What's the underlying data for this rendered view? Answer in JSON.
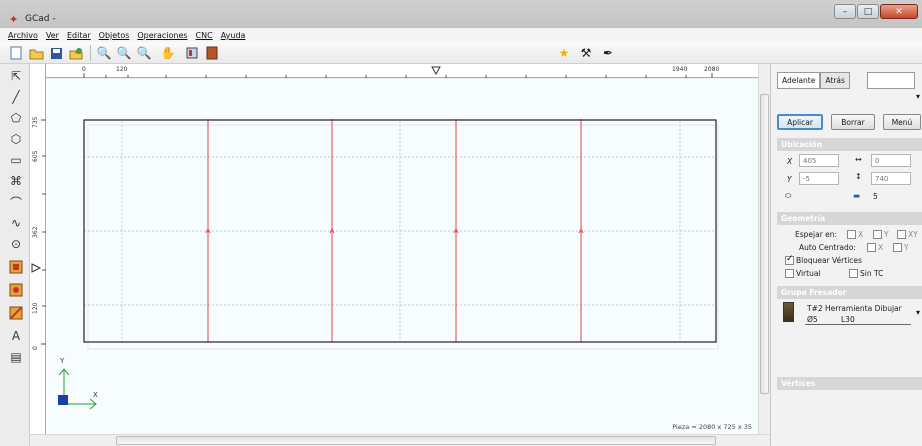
{
  "window": {
    "title": "GCad -"
  },
  "menu": [
    "Archivo",
    "Ver",
    "Editar",
    "Objetos",
    "Operaciones",
    "CNC",
    "Ayuda"
  ],
  "ruler": {
    "h_labels": [
      "0",
      "120",
      "1940",
      "2080"
    ],
    "v_labels": [
      "735",
      "605",
      "362",
      "120",
      "0"
    ]
  },
  "canvas": {
    "axis_x": "X",
    "axis_y": "Y",
    "status": "Pieza = 2080 x 725 x 35"
  },
  "panel": {
    "tab_forward": "Adelante",
    "tab_back": "Atrás",
    "btn_apply": "Aplicar",
    "btn_delete": "Borrar",
    "btn_menu": "Menú",
    "sect_location": "Ubicación",
    "x_label": "X",
    "x_value": "405",
    "y_label": "Y",
    "y_value": "-5",
    "w_value": "0",
    "h_value": "740",
    "depth_value": "5",
    "sect_geometry": "Geometría",
    "mirror_label": "Espejar en:",
    "mirror_x": "X",
    "mirror_y": "Y",
    "mirror_xy": "XY",
    "autocenter_label": "Auto Centrado:",
    "autocenter_x": "X",
    "autocenter_y": "Y",
    "lock_vertices": "Bloquear Vértices",
    "virtual": "Virtual",
    "sin_tc": "Sin TC",
    "sect_tool_group": "Grupo Fresador",
    "tool_name": "T#2  Herramienta Dibujar",
    "tool_diam": "Ø5",
    "tool_len": "L30",
    "sect_vertices": "Vértices"
  },
  "colors": {
    "part_border": "#222222",
    "cut_lines": "#e04848",
    "grid_lines": "#b8c4cc",
    "panel_header": "#d6d6d6"
  }
}
